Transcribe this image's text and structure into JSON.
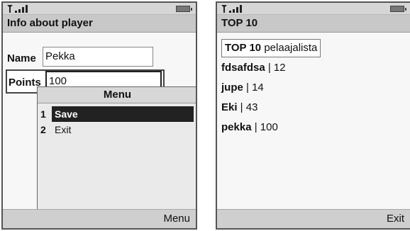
{
  "left_screen": {
    "title": "Info about player",
    "name_label": "Name",
    "name_value": "Pekka",
    "points_label": "Points",
    "points_value": "100",
    "menu": {
      "title": "Menu",
      "items": [
        {
          "num": "1",
          "label": "Save"
        },
        {
          "num": "2",
          "label": "Exit"
        }
      ]
    },
    "softkey": "Menu"
  },
  "right_screen": {
    "title": "TOP 10",
    "header_bold": "TOP 10",
    "header_rest": "pelaajalista",
    "rows": [
      {
        "name": "fdsafdsa",
        "score": "12"
      },
      {
        "name": "jupe",
        "score": "14"
      },
      {
        "name": "Eki",
        "score": "43"
      },
      {
        "name": "pekka",
        "score": "100"
      }
    ],
    "separator": " | ",
    "softkey": "Exit"
  },
  "icons": [
    "signal-icon",
    "battery-icon"
  ]
}
